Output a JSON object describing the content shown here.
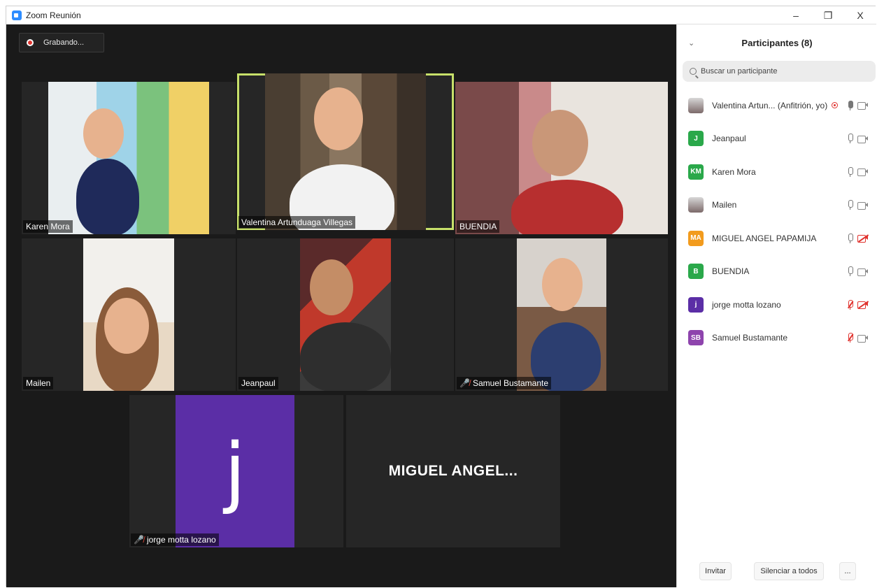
{
  "window": {
    "title": "Zoom Reunión",
    "controls": {
      "minimize": "–",
      "restore": "❐",
      "close": "X"
    }
  },
  "recording": {
    "label": "Grabando..."
  },
  "gallery": {
    "tiles": [
      {
        "name": "Karen Mora"
      },
      {
        "name": "Valentina Artunduaga Villegas"
      },
      {
        "name": "BUENDIA"
      },
      {
        "name": "Mailen"
      },
      {
        "name": "Jeanpaul"
      },
      {
        "name": "Samuel  Bustamante"
      },
      {
        "name": "jorge motta lozano",
        "avatar_letter": "j"
      },
      {
        "name": "MIGUEL  ANGEL..."
      }
    ]
  },
  "participants_panel": {
    "title": "Participantes (8)",
    "search_placeholder": "Buscar un participante",
    "participants": [
      {
        "name": "Valentina Artun... (Anfitrión, yo)",
        "avatar": "",
        "avatar_color": "#6b6b6b",
        "mic": "active",
        "video": "on",
        "recording": true
      },
      {
        "name": "Jeanpaul",
        "avatar": "J",
        "avatar_color": "#2aa84a",
        "mic": "on",
        "video": "on"
      },
      {
        "name": "Karen Mora",
        "avatar": "KM",
        "avatar_color": "#2aa84a",
        "mic": "on",
        "video": "on"
      },
      {
        "name": "Mailen",
        "avatar": "",
        "avatar_color": "#6b6b6b",
        "mic": "on",
        "video": "on"
      },
      {
        "name": "MIGUEL ANGEL PAPAMIJA",
        "avatar": "MA",
        "avatar_color": "#f29b1d",
        "mic": "on",
        "video": "off"
      },
      {
        "name": "BUENDIA",
        "avatar": "B",
        "avatar_color": "#2aa84a",
        "mic": "on",
        "video": "on"
      },
      {
        "name": "jorge motta lozano",
        "avatar": "j",
        "avatar_color": "#5b2ea6",
        "mic": "muted",
        "video": "off"
      },
      {
        "name": "Samuel  Bustamante",
        "avatar": "SB",
        "avatar_color": "#8e44ad",
        "mic": "muted",
        "video": "on"
      }
    ],
    "footer": {
      "invite": "Invitar",
      "mute_all": "Silenciar a todos",
      "more": "..."
    }
  }
}
